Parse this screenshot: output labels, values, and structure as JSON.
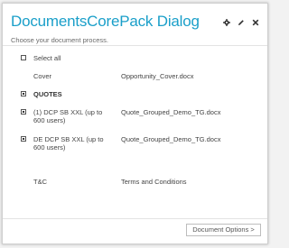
{
  "dialog": {
    "title": "DocumentsCorePack Dialog",
    "subtitle": "Choose your document process."
  },
  "header_icons": [
    {
      "name": "gear-icon"
    },
    {
      "name": "pencil-icon"
    },
    {
      "name": "close-icon"
    }
  ],
  "select_all": {
    "label": "Select all",
    "checked": false
  },
  "cover": {
    "name": "Cover",
    "file": "Opportunity_Cover.docx"
  },
  "quotes": {
    "label": "QUOTES",
    "checked": true,
    "items": [
      {
        "name": "(1) DCP SB XXL (up to 600 users)",
        "file": "Quote_Grouped_Demo_TG.docx",
        "checked": true
      },
      {
        "name": "DE DCP SB XXL (up to 600 users)",
        "file": "Quote_Grouped_Demo_TG.docx",
        "checked": true
      }
    ]
  },
  "tc": {
    "name": "T&C",
    "file": "Terms and Conditions"
  },
  "footer": {
    "options_button": "Document Options >"
  },
  "colors": {
    "title": "#1a9fc9",
    "text": "#444444"
  }
}
